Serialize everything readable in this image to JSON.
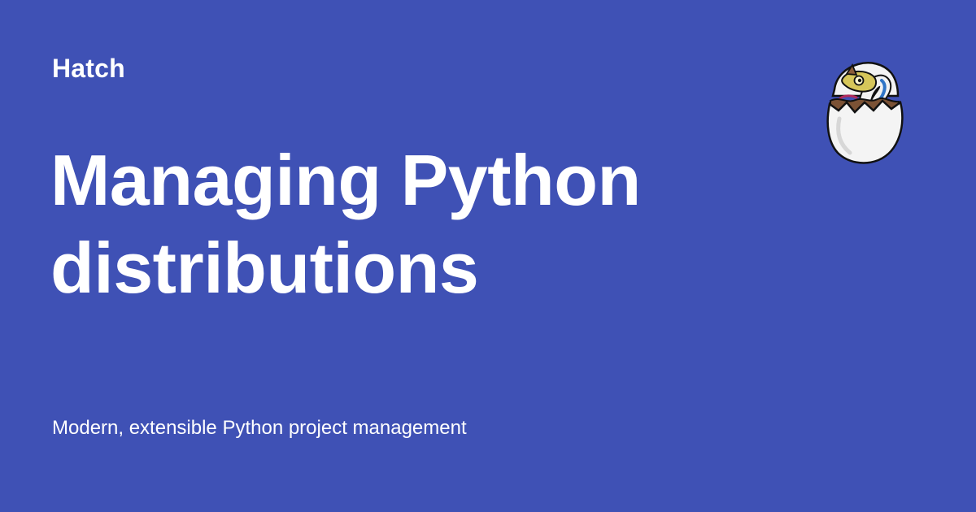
{
  "site": {
    "name": "Hatch"
  },
  "page": {
    "title_lines": [
      "Managing Python",
      "distributions"
    ],
    "description": "Modern, extensible Python project management"
  },
  "logo": {
    "icon": "hatching-snake-egg-icon"
  },
  "colors": {
    "background": "#3f51b5",
    "text": "#ffffff"
  }
}
